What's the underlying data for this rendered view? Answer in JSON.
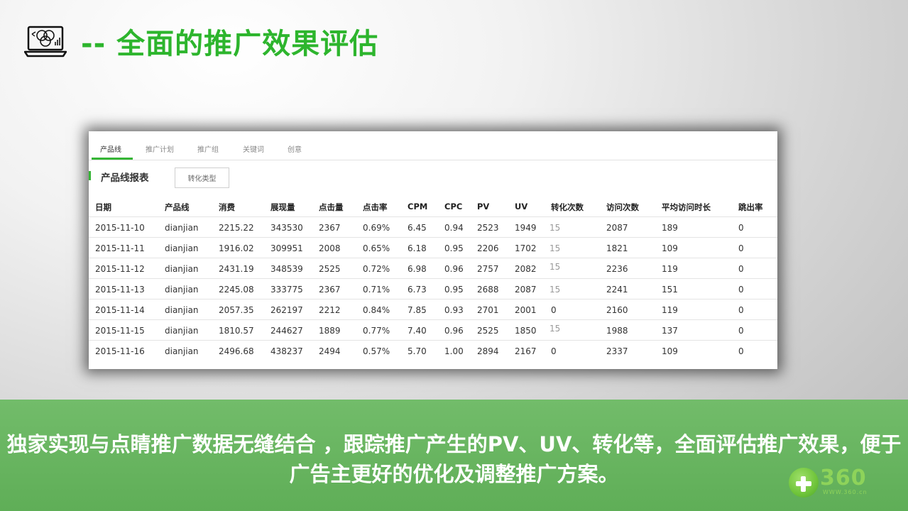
{
  "slide": {
    "title": "-- 全面的推广效果评估",
    "bottom_text": "独家实现与点睛推广数据无缝结合 ，跟踪推广产生的PV、UV、转化等，全面评估推广效果，便于广告主更好的优化及调整推广方案。"
  },
  "logo": {
    "text": "360",
    "url": "WWW.360.cn"
  },
  "panel": {
    "tabs": [
      "产品线",
      "推广计划",
      "推广组",
      "关键词",
      "创意"
    ],
    "active_tab": "产品线",
    "report_title": "产品线报表",
    "conversion_button": "转化类型",
    "columns": [
      "日期",
      "产品线",
      "消费",
      "展现量",
      "点击量",
      "点击率",
      "CPM",
      "CPC",
      "PV",
      "UV",
      "转化次数",
      "访问次数",
      "平均访问时长",
      "跳出率"
    ],
    "rows": [
      [
        "2015-11-10",
        "dianjian",
        "2215.22",
        "343530",
        "2367",
        "0.69%",
        "6.45",
        "0.94",
        "2523",
        "1949",
        "15",
        "2087",
        "189",
        "0"
      ],
      [
        "2015-11-11",
        "dianjian",
        "1916.02",
        "309951",
        "2008",
        "0.65%",
        "6.18",
        "0.95",
        "2206",
        "1702",
        "15",
        "1821",
        "109",
        "0"
      ],
      [
        "2015-11-12",
        "dianjian",
        "2431.19",
        "348539",
        "2525",
        "0.72%",
        "6.98",
        "0.96",
        "2757",
        "2082",
        "15",
        "2236",
        "119",
        "0"
      ],
      [
        "2015-11-13",
        "dianjian",
        "2245.08",
        "333775",
        "2367",
        "0.71%",
        "6.73",
        "0.95",
        "2688",
        "2087",
        "15",
        "2241",
        "151",
        "0"
      ],
      [
        "2015-11-14",
        "dianjian",
        "2057.35",
        "262197",
        "2212",
        "0.84%",
        "7.85",
        "0.93",
        "2701",
        "2001",
        "0",
        "2160",
        "119",
        "0"
      ],
      [
        "2015-11-15",
        "dianjian",
        "1810.57",
        "244627",
        "1889",
        "0.77%",
        "7.40",
        "0.96",
        "2525",
        "1850",
        "15",
        "1988",
        "137",
        "0"
      ],
      [
        "2015-11-16",
        "dianjian",
        "2496.68",
        "438237",
        "2494",
        "0.57%",
        "5.70",
        "1.00",
        "2894",
        "2167",
        "0",
        "2337",
        "109",
        "0"
      ]
    ]
  },
  "colors": {
    "accent_green": "#2db52d",
    "banner_green": "#66b35e",
    "logo_green": "#8ed35a"
  },
  "icons": {
    "title_icon": "laptop-venn-icon",
    "logo_icon": "plus-logo-icon"
  }
}
